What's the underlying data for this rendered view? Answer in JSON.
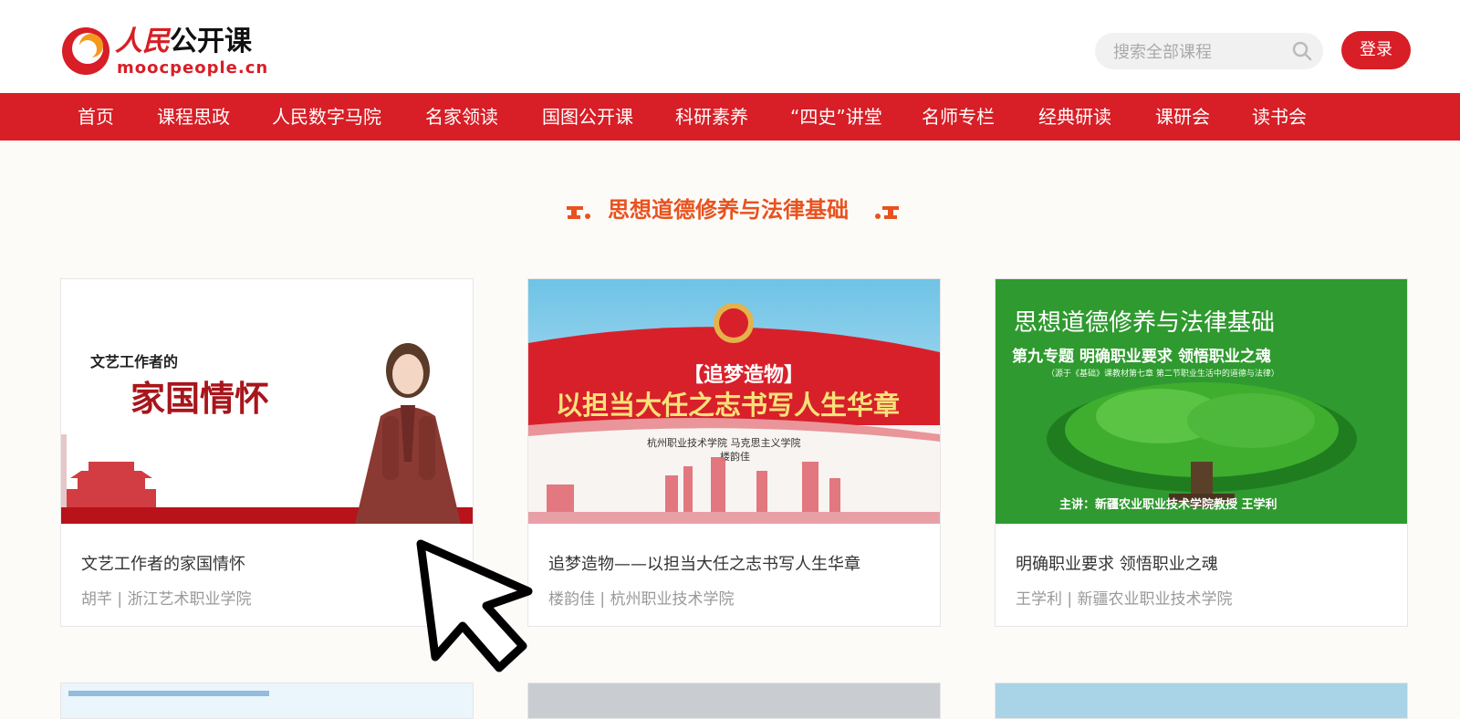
{
  "header": {
    "logo_cn_red": "人民",
    "logo_cn": "公开课",
    "logo_en": "moocpeople.cn",
    "search_placeholder": "搜索全部课程",
    "login_label": "登录"
  },
  "nav": {
    "items": [
      "首页",
      "课程思政",
      "人民数字马院",
      "名家领读",
      "国图公开课",
      "科研素养",
      "“四史”讲堂",
      "名师专栏",
      "经典研读",
      "课研会",
      "读书会"
    ]
  },
  "section": {
    "title": "思想道德修养与法律基础"
  },
  "cards": [
    {
      "title": "文艺工作者的家国情怀",
      "meta": "胡芊 | 浙江艺术职业学院",
      "thumb_small": "文艺工作者的",
      "thumb_big": "家国情怀"
    },
    {
      "title": "追梦造物——以担当大任之志书写人生华章",
      "meta": "楼韵佳 | 杭州职业技术学院",
      "thumb_tag": "【追梦造物】",
      "thumb_big": "以担当大任之志书写人生华章",
      "thumb_sub1": "杭州职业技术学院  马克思主义学院",
      "thumb_sub2": "楼韵佳"
    },
    {
      "title": "明确职业要求 领悟职业之魂",
      "meta": "王学利 | 新疆农业职业技术学院",
      "thumb_head": "思想道德修养与法律基础",
      "thumb_topic": "第九专题 明确职业要求 领悟职业之魂",
      "thumb_source": "（源于《基础》课教材第七章 第二节职业生活中的道德与法律）",
      "thumb_speaker": "主讲：新疆农业职业技术学院教授  王学利"
    }
  ],
  "colors": {
    "brand_red": "#d81e26",
    "section_orange": "#e8521f",
    "tree_green": "#2f9a2f"
  }
}
